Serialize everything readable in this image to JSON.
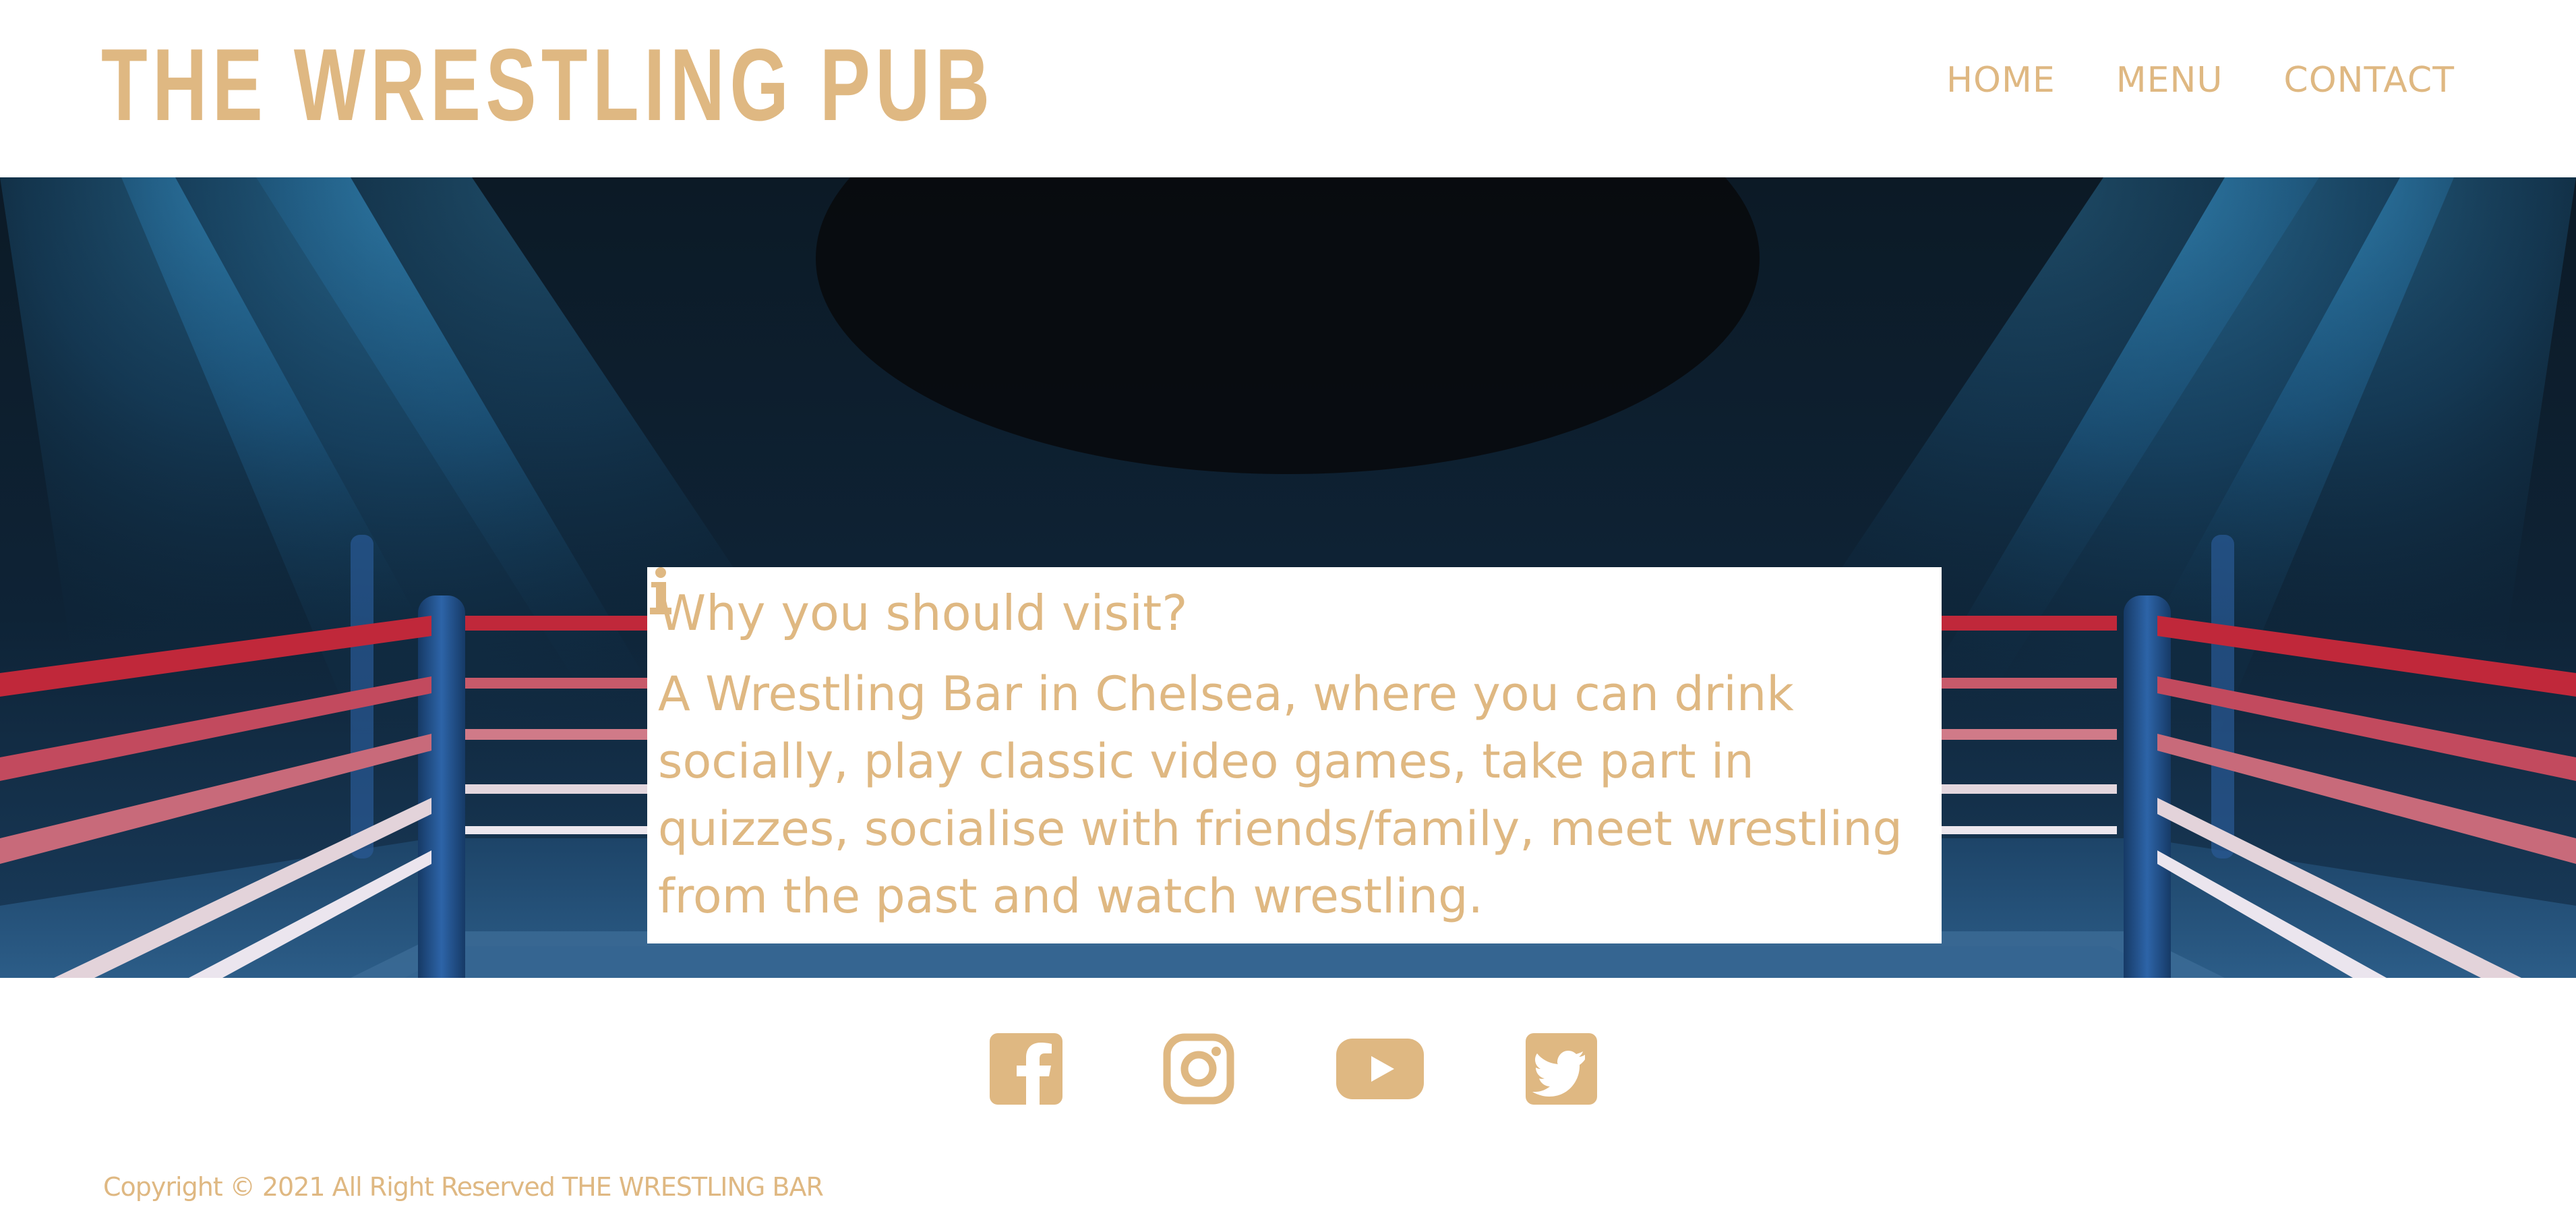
{
  "header": {
    "brand": "THE WRESTLING PUB",
    "nav": [
      {
        "label": "HOME"
      },
      {
        "label": "MENU"
      },
      {
        "label": "CONTACT"
      }
    ]
  },
  "hero": {
    "title": "Why you should visit?",
    "title_icon": "info-icon",
    "text": "A Wrestling Bar in Chelsea, where you can drink socially, play classic video games, take part in quizzes, socialise with friends/family, meet wrestling from the past and watch wrestling."
  },
  "footer": {
    "social": [
      {
        "icon": "facebook-icon"
      },
      {
        "icon": "instagram-icon"
      },
      {
        "icon": "youtube-icon"
      },
      {
        "icon": "twitter-icon"
      }
    ],
    "copyright": "Copyright © 2021 All Right Reserved THE WRESTLING BAR"
  },
  "colors": {
    "accent": "#dfb882",
    "background": "#ffffff",
    "hero_dark": "#0a1824",
    "rope_red": "#c0283a",
    "rope_white": "#e8e4ea",
    "post_blue": "#1e4d86"
  }
}
